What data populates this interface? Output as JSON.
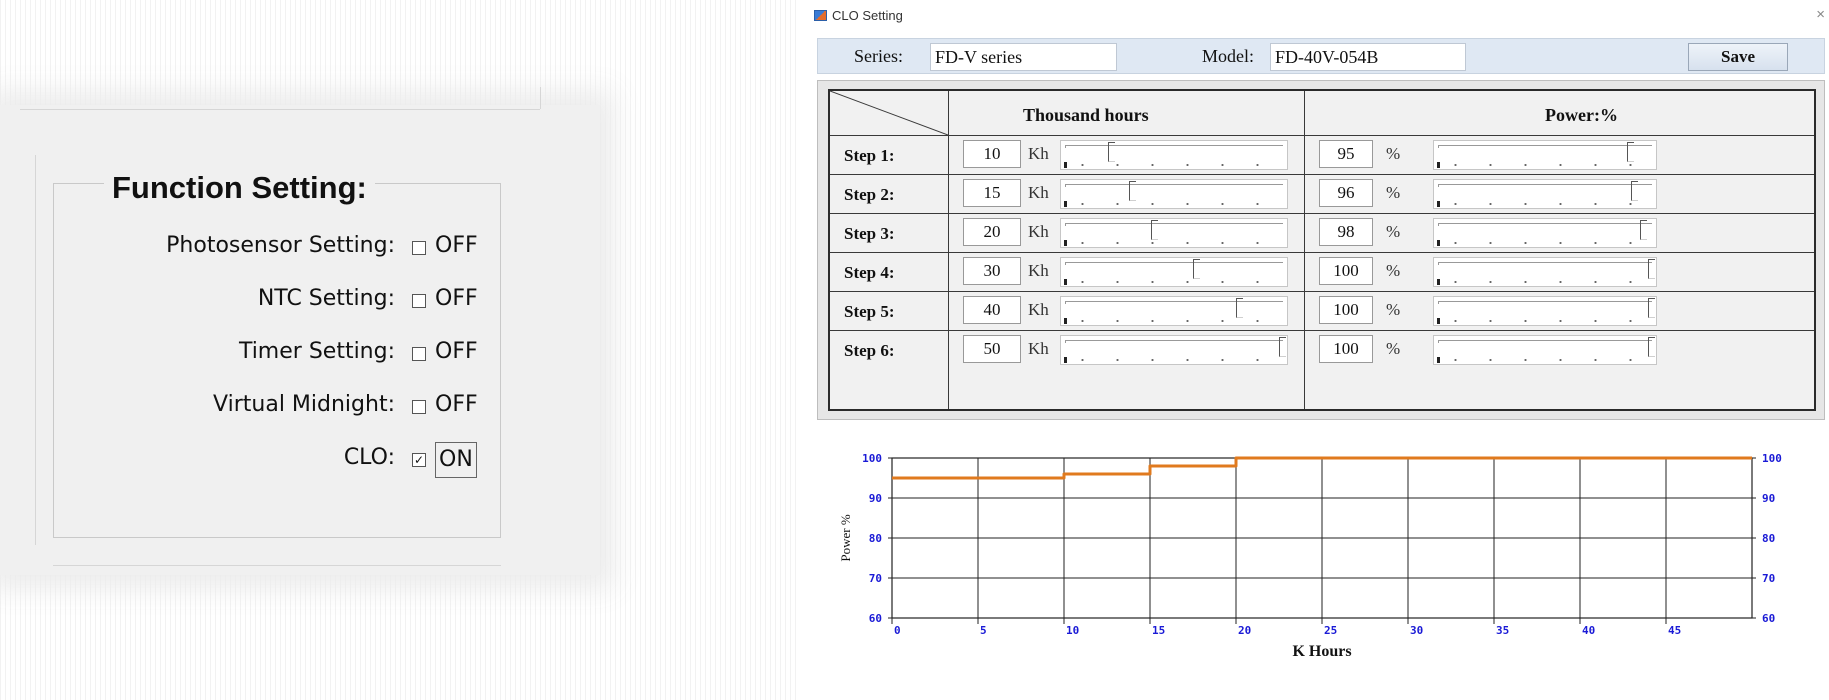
{
  "function_setting": {
    "title": "Function Setting:",
    "rows": [
      {
        "label": "Photosensor Setting:",
        "checked": false,
        "value": "OFF"
      },
      {
        "label": "NTC Setting:",
        "checked": false,
        "value": "OFF"
      },
      {
        "label": "Timer Setting:",
        "checked": false,
        "value": "OFF"
      },
      {
        "label": "Virtual Midnight:",
        "checked": false,
        "value": "OFF"
      },
      {
        "label": "CLO:",
        "checked": true,
        "value": "ON",
        "check_glyph": "✓"
      }
    ]
  },
  "clo_window": {
    "title": "CLO Setting",
    "close_glyph": "×",
    "series_label": "Series:",
    "series_value": "FD-V series",
    "model_label": "Model:",
    "model_value": "FD-40V-054B",
    "save_label": "Save",
    "col_hours": "Thousand hours",
    "col_power": "Power:%",
    "hours_unit": "Kh",
    "power_unit": "%",
    "hours_slider_max": 50,
    "power_slider_min": 50,
    "power_slider_max": 100,
    "steps": [
      {
        "label": "Step 1:",
        "hours": "10",
        "power": "95"
      },
      {
        "label": "Step 2:",
        "hours": "15",
        "power": "96"
      },
      {
        "label": "Step 3:",
        "hours": "20",
        "power": "98"
      },
      {
        "label": "Step 4:",
        "hours": "30",
        "power": "100"
      },
      {
        "label": "Step 5:",
        "hours": "40",
        "power": "100"
      },
      {
        "label": "Step 6:",
        "hours": "50",
        "power": "100"
      }
    ]
  },
  "chart_data": {
    "type": "line",
    "title": "",
    "xlabel": "K Hours",
    "ylabel": "Power %",
    "xlim": [
      0,
      50
    ],
    "ylim": [
      60,
      100
    ],
    "x_ticks": [
      "0",
      "5",
      "10",
      "15",
      "20",
      "25",
      "30",
      "35",
      "40",
      "45"
    ],
    "y_ticks": [
      "100",
      "90",
      "80",
      "70",
      "60"
    ],
    "grid": true,
    "line_color": "#e07a1e",
    "tick_color": "#1a1ad6",
    "series": [
      {
        "x": [
          0,
          10,
          10,
          15,
          15,
          20,
          20,
          50
        ],
        "y": [
          95,
          95,
          96,
          96,
          98,
          98,
          100,
          100
        ]
      }
    ]
  }
}
